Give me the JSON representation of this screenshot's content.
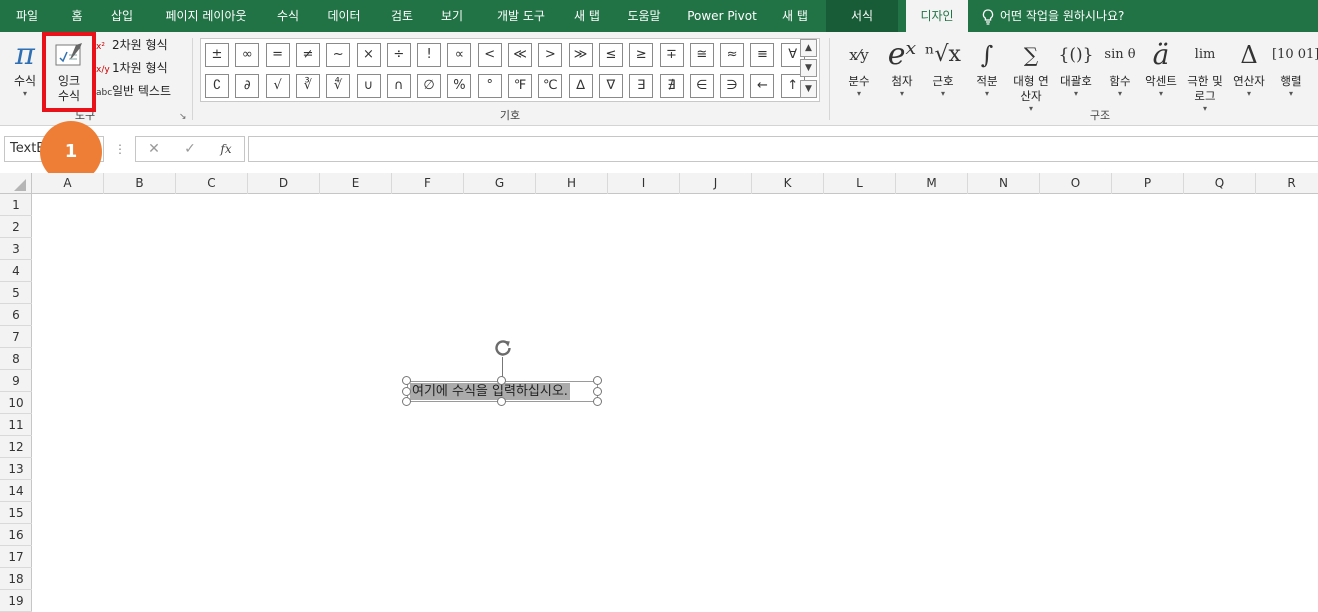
{
  "tabs": [
    {
      "label": "파일"
    },
    {
      "label": "홈"
    },
    {
      "label": "삽입"
    },
    {
      "label": "페이지 레이아웃"
    },
    {
      "label": "수식"
    },
    {
      "label": "데이터"
    },
    {
      "label": "검토"
    },
    {
      "label": "보기"
    },
    {
      "label": "개발 도구"
    },
    {
      "label": "새 탭"
    },
    {
      "label": "도움말"
    },
    {
      "label": "Power Pivot"
    },
    {
      "label": "새 탭"
    },
    {
      "label": "서식"
    },
    {
      "label": "디자인"
    }
  ],
  "tell_me": "어떤 작업을 원하시나요?",
  "tools": {
    "equation_label": "수식",
    "ink_label": "잉크 수식",
    "professional": "2차원 형식",
    "linear": "1차원 형식",
    "normal_text": "일반 텍스트",
    "group_label": "도구"
  },
  "symbols": {
    "group_label": "기호",
    "row1": [
      "±",
      "∞",
      "=",
      "≠",
      "~",
      "×",
      "÷",
      "!",
      "∝",
      "<",
      "≪",
      ">",
      "≫",
      "≤",
      "≥",
      "∓",
      "≅",
      "≈",
      "≡",
      "∀"
    ],
    "row2": [
      "∁",
      "∂",
      "√",
      "∛",
      "∜",
      "∪",
      "∩",
      "∅",
      "%",
      "°",
      "℉",
      "℃",
      "∆",
      "∇",
      "∃",
      "∄",
      "∈",
      "∋",
      "←",
      "↑"
    ]
  },
  "structures": {
    "group_label": "구조",
    "items": [
      {
        "glyph": "x⁄y",
        "label": "분수"
      },
      {
        "glyph": "eˣ",
        "label": "첨자"
      },
      {
        "glyph": "ⁿ√x",
        "label": "근호"
      },
      {
        "glyph": "∫",
        "label": "적분"
      },
      {
        "glyph": "∑",
        "label": "대형 연산자"
      },
      {
        "glyph": "{()}",
        "label": "대괄호"
      },
      {
        "glyph": "sin θ",
        "label": "함수"
      },
      {
        "glyph": "ä",
        "label": "악센트"
      },
      {
        "glyph": "lim",
        "label": "극한 및 로그"
      },
      {
        "glyph": "Δ",
        "label": "연산자"
      },
      {
        "glyph": "[10 01]",
        "label": "행렬"
      }
    ]
  },
  "formula_bar": {
    "name_box": "TextBox",
    "fx": "fx"
  },
  "columns": [
    "A",
    "B",
    "C",
    "D",
    "E",
    "F",
    "G",
    "H",
    "I",
    "J",
    "K",
    "L",
    "M",
    "N",
    "O",
    "P",
    "Q",
    "R"
  ],
  "rows": [
    "1",
    "2",
    "3",
    "4",
    "5",
    "6",
    "7",
    "8",
    "9",
    "10",
    "11",
    "12",
    "13",
    "14",
    "15",
    "16",
    "17",
    "18",
    "19"
  ],
  "equation_placeholder": "여기에 수식을 입력하십시오.",
  "badge": "1"
}
